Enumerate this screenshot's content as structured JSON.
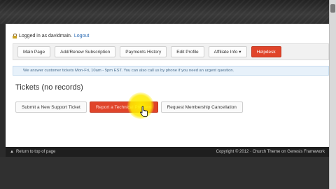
{
  "login": {
    "prefix": "Logged in as davidmain.",
    "logout": "Logout"
  },
  "menu": [
    {
      "label": "Main Page"
    },
    {
      "label": "Add/Renew Subscription"
    },
    {
      "label": "Payments History"
    },
    {
      "label": "Edit Profile"
    },
    {
      "label": "Affiliate Info ▾"
    },
    {
      "label": "Helpdesk",
      "accent": "#e0442a"
    }
  ],
  "notice": {
    "text": "We answer customer tickets Mon-Fri, 10am - 5pm EST. You can also call us by phone if you need an urgent question."
  },
  "tickets": {
    "heading": "Tickets (no records)"
  },
  "actions": [
    {
      "label": "Submit a New Support Ticket"
    },
    {
      "label": "Report a Technical Problem",
      "accent": "#e0442a"
    },
    {
      "label": "Request Membership Cancellation"
    }
  ],
  "footer": {
    "back": "Return to top of page",
    "copyright": "Copyright © 2012 · Church Theme on Genesis Framework"
  }
}
